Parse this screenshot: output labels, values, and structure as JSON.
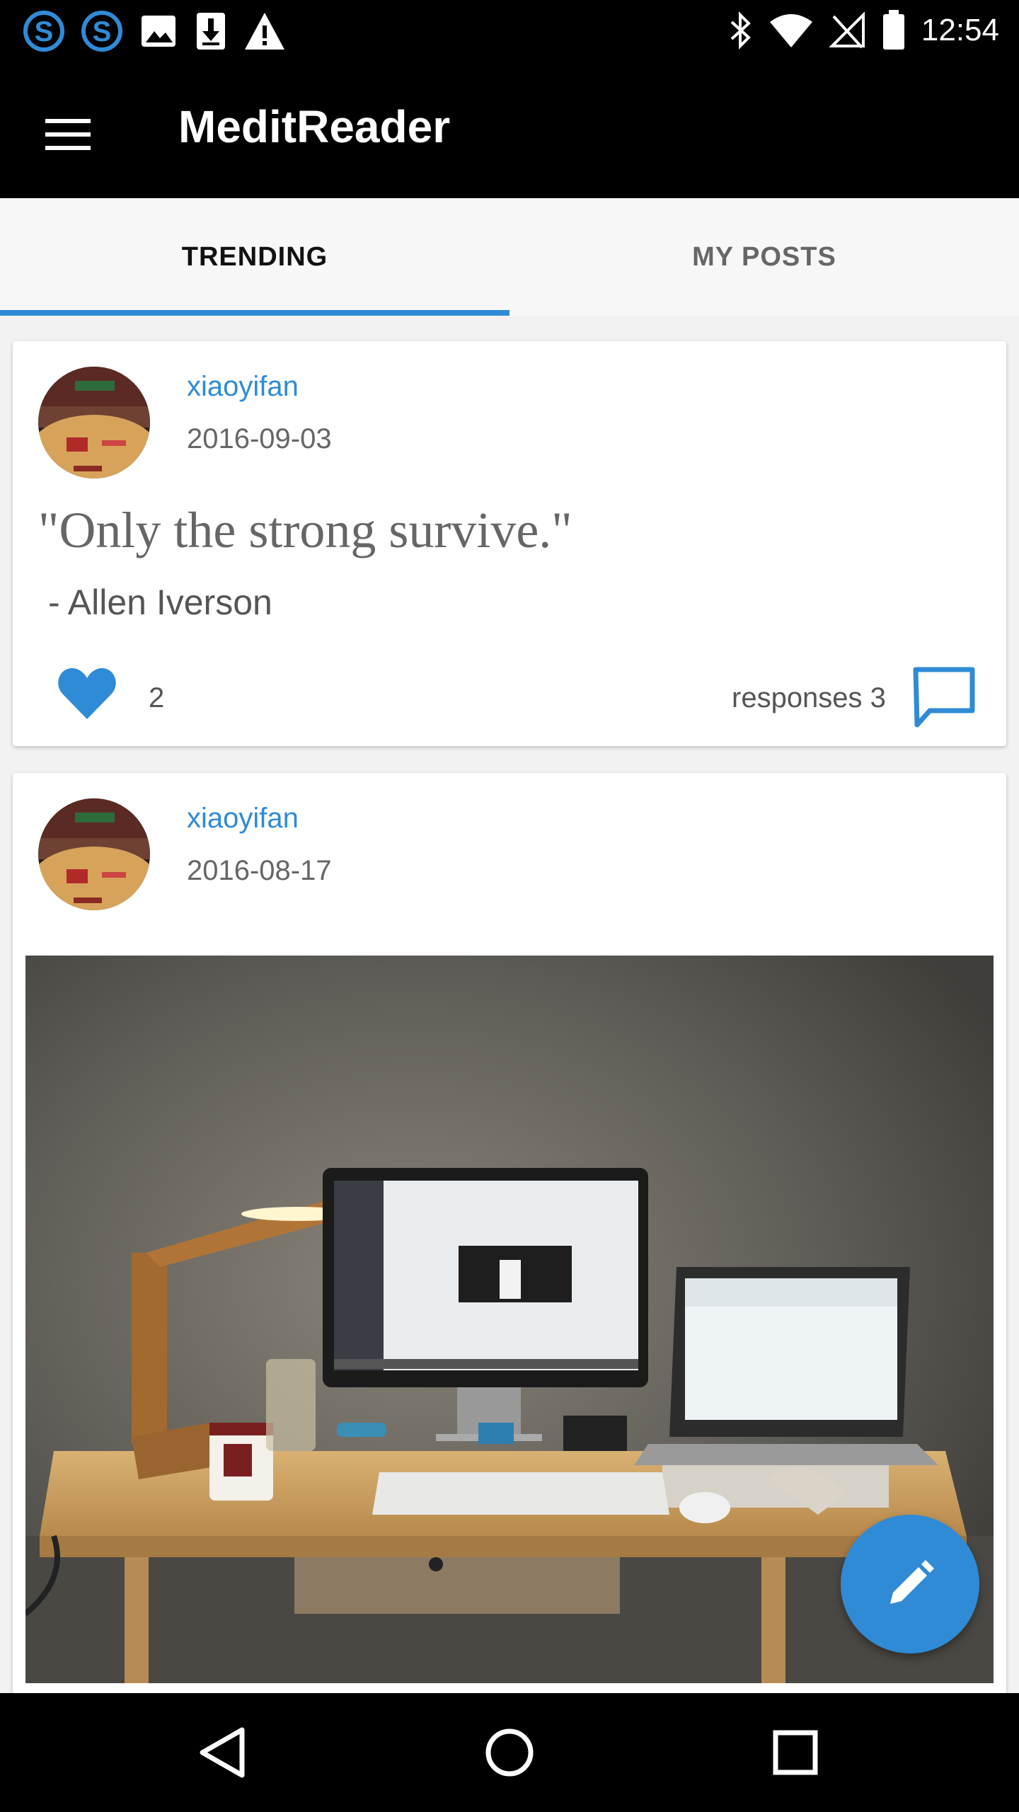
{
  "status_bar": {
    "time": "12:54",
    "left_icons": [
      "skype-icon",
      "skype-icon",
      "image-icon",
      "download-icon",
      "warning-icon"
    ],
    "right_icons": [
      "bluetooth-icon",
      "wifi-icon",
      "no-signal-icon",
      "battery-icon"
    ]
  },
  "app_bar": {
    "title": "MeditReader",
    "menu_icon": "hamburger-menu-icon"
  },
  "tabs": [
    {
      "label": "TRENDING",
      "active": true
    },
    {
      "label": "MY POSTS",
      "active": false
    }
  ],
  "posts": [
    {
      "username": "xiaoyifan",
      "date": "2016-09-03",
      "quote": "\"Only the strong survive.\"",
      "author": "-  Allen Iverson",
      "likes": "2",
      "responses": "responses 3"
    },
    {
      "username": "xiaoyifan",
      "date": "2016-08-17",
      "image": "desk-photo"
    }
  ],
  "fab": {
    "icon": "pencil-edit-icon"
  },
  "nav_bar": {
    "icons": [
      "back-triangle-icon",
      "home-circle-icon",
      "recents-square-icon"
    ]
  },
  "colors": {
    "accent": "#2f8bd6",
    "appbar": "#000000",
    "background": "#f2f2f2"
  }
}
